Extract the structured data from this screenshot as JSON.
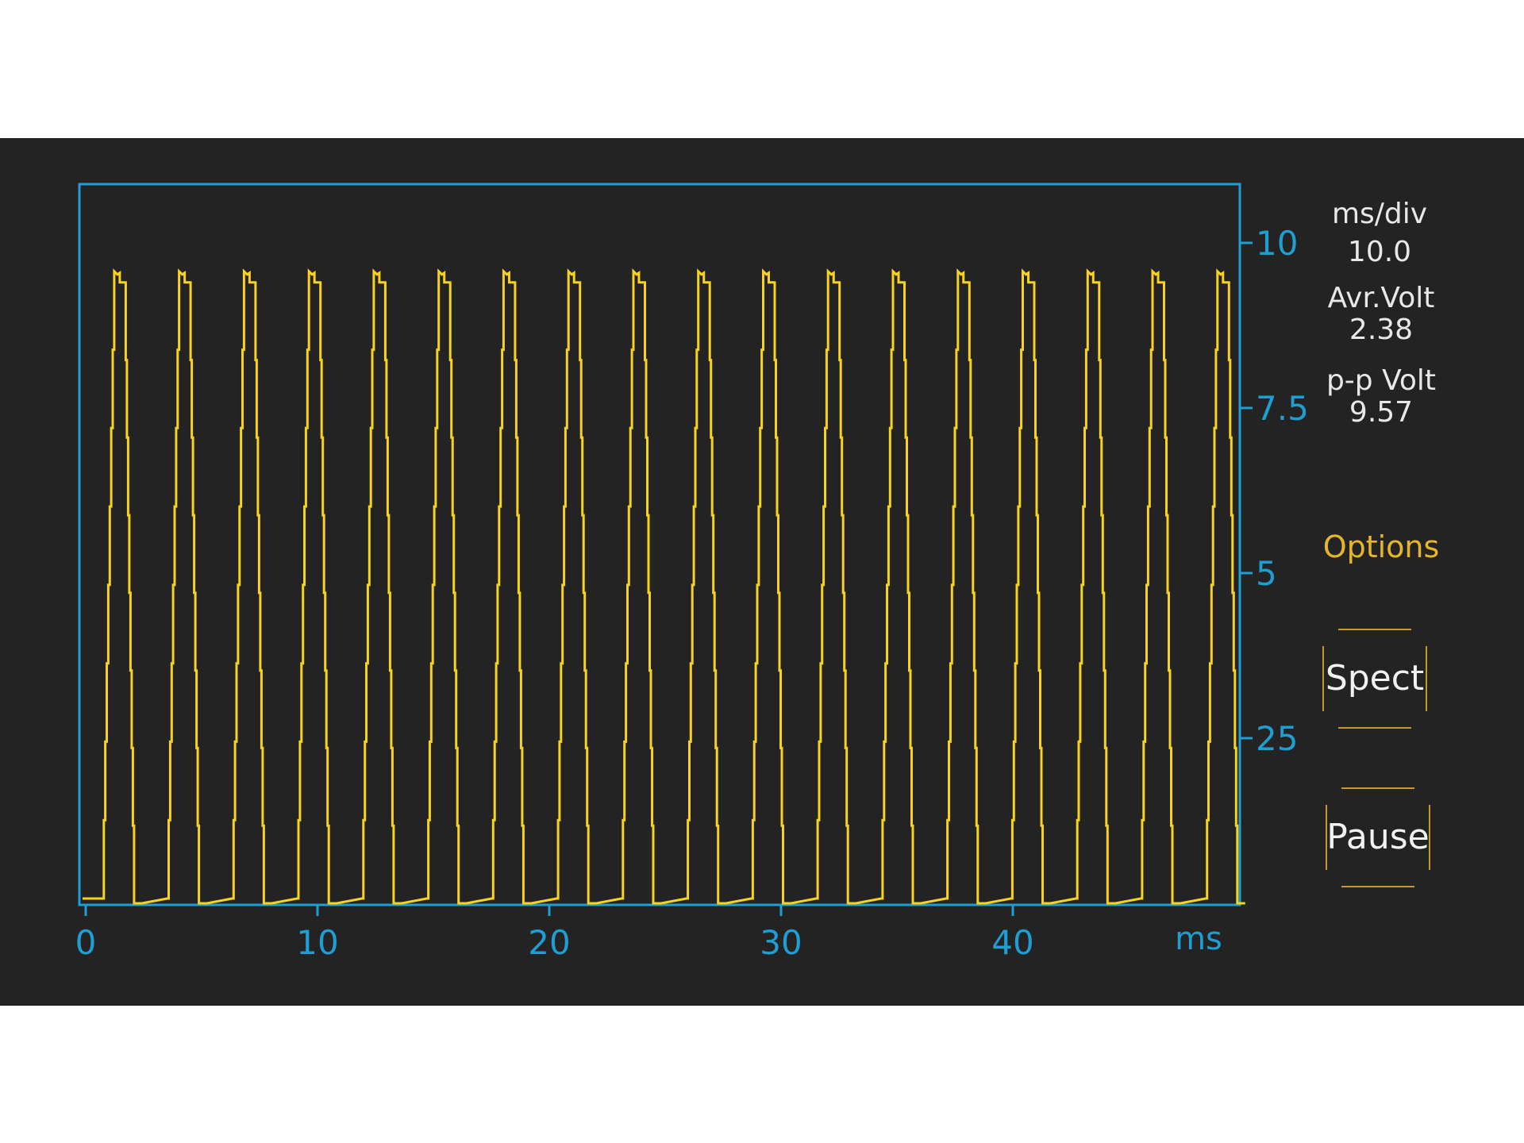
{
  "readouts": {
    "ms_div_label": "ms/div",
    "ms_div_value": "10.0",
    "avr_volt_label": "Avr.Volt",
    "avr_volt_value": "2.38",
    "pp_volt_label": "p-p Volt",
    "pp_volt_value": "9.57"
  },
  "controls": {
    "options_label": "Options",
    "spect_label": "Spect",
    "pause_label": "Pause"
  },
  "colors": {
    "background": "#232323",
    "axis": "#1e9fd4",
    "trace": "#f7d21e",
    "accent": "#e6b62a"
  },
  "chart_data": {
    "type": "line",
    "xlabel": "ms",
    "ylabel": "",
    "x_ticks": [
      "0",
      "10",
      "20",
      "30",
      "40"
    ],
    "x_tick_values": [
      0,
      10,
      20,
      30,
      40
    ],
    "y_ticks": [
      "10",
      "7.5",
      "5",
      "25"
    ],
    "y_tick_values": [
      10,
      7.5,
      5,
      2.5
    ],
    "xlim": [
      0,
      50
    ],
    "ylim": [
      -0.3,
      10.7
    ],
    "grid": false,
    "series": [
      {
        "pulse_times_ms": [
          1.4,
          4.2,
          7.0,
          9.8,
          12.6,
          15.4,
          18.2,
          21.0,
          23.8,
          26.6,
          29.4,
          32.2,
          35.0,
          37.8,
          40.6,
          43.4,
          46.2,
          49.0
        ],
        "peak_volts": 9.57,
        "baseline_volts": 0.0
      }
    ]
  }
}
